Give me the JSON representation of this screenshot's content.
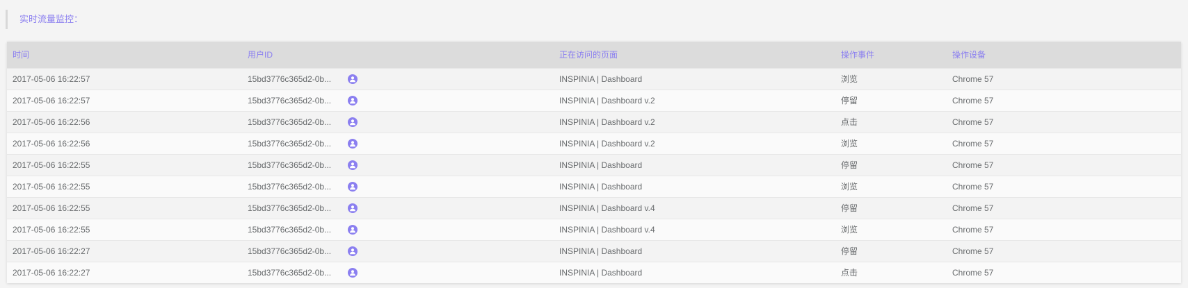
{
  "header": {
    "title": "实时流量监控："
  },
  "table": {
    "columns": [
      "时间",
      "用户ID",
      "正在访问的页面",
      "操作事件",
      "操作设备"
    ],
    "rows": [
      {
        "time": "2017-05-06 16:22:57",
        "user_id": "15bd3776c365d2-0b...",
        "page": "INSPINIA | Dashboard",
        "event": "浏览",
        "device": "Chrome 57"
      },
      {
        "time": "2017-05-06 16:22:57",
        "user_id": "15bd3776c365d2-0b...",
        "page": "INSPINIA | Dashboard v.2",
        "event": "停留",
        "device": "Chrome 57"
      },
      {
        "time": "2017-05-06 16:22:56",
        "user_id": "15bd3776c365d2-0b...",
        "page": "INSPINIA | Dashboard v.2",
        "event": "点击",
        "device": "Chrome 57"
      },
      {
        "time": "2017-05-06 16:22:56",
        "user_id": "15bd3776c365d2-0b...",
        "page": "INSPINIA | Dashboard v.2",
        "event": "浏览",
        "device": "Chrome 57"
      },
      {
        "time": "2017-05-06 16:22:55",
        "user_id": "15bd3776c365d2-0b...",
        "page": "INSPINIA | Dashboard",
        "event": "停留",
        "device": "Chrome 57"
      },
      {
        "time": "2017-05-06 16:22:55",
        "user_id": "15bd3776c365d2-0b...",
        "page": "INSPINIA | Dashboard",
        "event": "浏览",
        "device": "Chrome 57"
      },
      {
        "time": "2017-05-06 16:22:55",
        "user_id": "15bd3776c365d2-0b...",
        "page": "INSPINIA | Dashboard v.4",
        "event": "停留",
        "device": "Chrome 57"
      },
      {
        "time": "2017-05-06 16:22:55",
        "user_id": "15bd3776c365d2-0b...",
        "page": "INSPINIA | Dashboard v.4",
        "event": "浏览",
        "device": "Chrome 57"
      },
      {
        "time": "2017-05-06 16:22:27",
        "user_id": "15bd3776c365d2-0b...",
        "page": "INSPINIA | Dashboard",
        "event": "停留",
        "device": "Chrome 57"
      },
      {
        "time": "2017-05-06 16:22:27",
        "user_id": "15bd3776c365d2-0b...",
        "page": "INSPINIA | Dashboard",
        "event": "点击",
        "device": "Chrome 57"
      }
    ]
  },
  "icons": {
    "user_id_icon": "user-icon"
  },
  "colors": {
    "accent": "#8b7ff0",
    "header_bg": "#dcdcdc",
    "text": "#676a6c"
  }
}
